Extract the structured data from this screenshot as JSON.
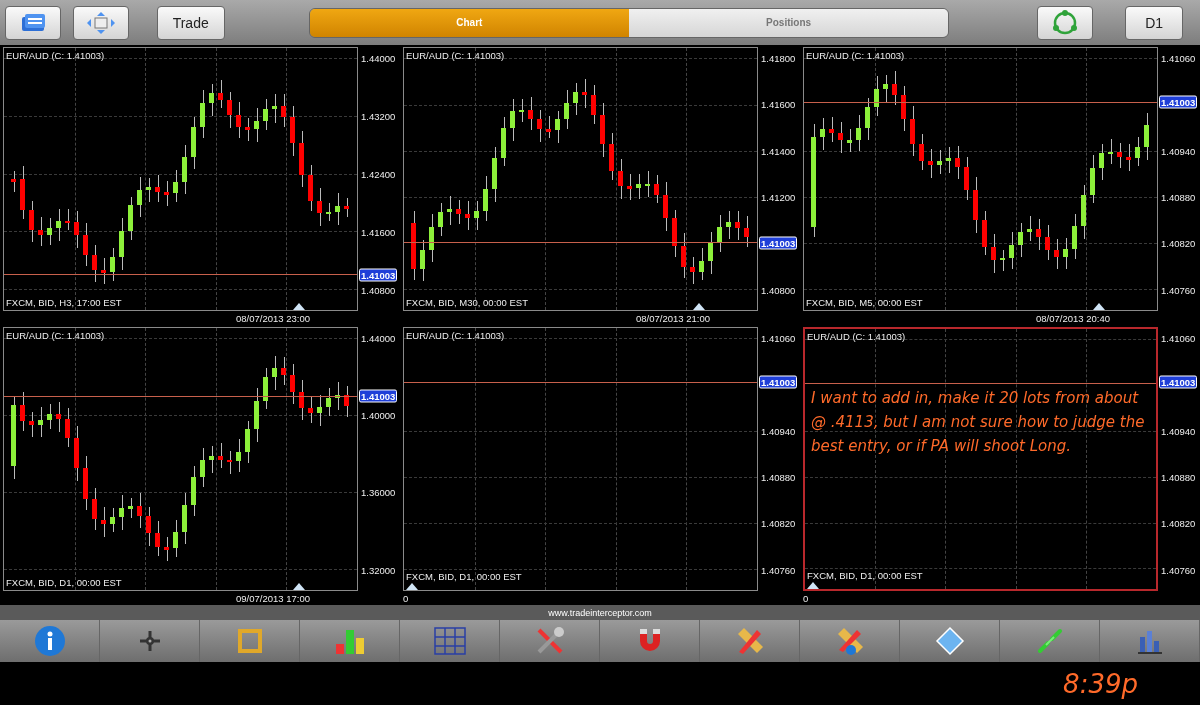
{
  "top_bar": {
    "trade_button": "Trade",
    "view_tabs": [
      {
        "label": "Chart",
        "selected": true
      },
      {
        "label": "Positions",
        "selected": false
      }
    ],
    "timeframe_button": "D1"
  },
  "charts": [
    {
      "kind": "candles",
      "title": "EUR/AUD (C: 1.41003)",
      "yticks": [
        "1.44000",
        "1.43200",
        "1.42400",
        "1.41600",
        "1.40800"
      ],
      "price_tag": "1.41003",
      "footer": "FXCM, BID, H3, 17:00 EST",
      "x_label": "08/07/2013 23:00",
      "selected": false
    },
    {
      "kind": "candles",
      "title": "EUR/AUD (C: 1.41003)",
      "yticks": [
        "1.41800",
        "1.41600",
        "1.41400",
        "1.41200",
        "1.40800"
      ],
      "price_tag": "1.41003",
      "footer": "FXCM, BID, M30, 00:00 EST",
      "x_label": "08/07/2013 21:00",
      "selected": false
    },
    {
      "kind": "candles",
      "title": "EUR/AUD (C: 1.41003)",
      "yticks": [
        "1.41060",
        "1.40940",
        "1.40880",
        "1.40820",
        "1.40760"
      ],
      "price_tag": "1.41003",
      "footer": "FXCM, BID, M5, 00:00 EST",
      "x_label": "08/07/2013 20:40",
      "selected": false
    },
    {
      "kind": "candles",
      "title": "EUR/AUD (C: 1.41003)",
      "yticks": [
        "1.44000",
        "1.40000",
        "1.36000",
        "1.32000"
      ],
      "price_tag": "1.41003",
      "footer": "FXCM, BID, D1, 00:00 EST",
      "x_label": "09/07/2013 17:00",
      "selected": false
    },
    {
      "kind": "empty",
      "title": "EUR/AUD (C: 1.41003)",
      "yticks": [
        "1.41060",
        "1.40940",
        "1.40880",
        "1.40820",
        "1.40760"
      ],
      "price_tag": "1.41003",
      "footer": "FXCM, BID, D1, 00:00 EST",
      "x_label": "0",
      "selected": false
    },
    {
      "kind": "empty",
      "title": "EUR/AUD (C: 1.41003)",
      "yticks": [
        "1.41060",
        "1.40940",
        "1.40880",
        "1.40820",
        "1.40760"
      ],
      "price_tag": "1.41003",
      "footer": "FXCM, BID, D1, 00:00 EST",
      "x_label": "0",
      "selected": true,
      "note": "I want to add in, make it 20 lots from about @ .4113, but I am not sure how to judge the best entry, or if PA will shoot Long."
    }
  ],
  "site_url": "www.tradeinterceptor.com",
  "handwritten_time": "8:39p"
}
